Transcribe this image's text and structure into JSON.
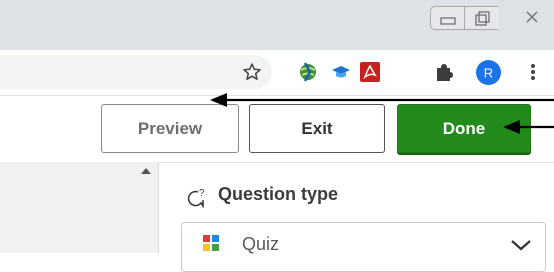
{
  "window_controls": {
    "minimize": "minimize",
    "maximize": "maximize",
    "close": "close"
  },
  "toolbar": {
    "icons": [
      "star-icon",
      "globe-extension-icon",
      "graduation-cap-icon",
      "pdf-icon",
      "puzzle-icon",
      "profile-avatar",
      "more-vert-icon"
    ],
    "avatar_letter": "R",
    "avatar_color": "#1a73e8",
    "pdf_color": "#c5221f"
  },
  "editor": {
    "preview_label": "Preview",
    "exit_label": "Exit",
    "done_label": "Done",
    "done_color": "#238b1c"
  },
  "question_panel": {
    "title": "Question type",
    "selected_type": "Quiz"
  }
}
